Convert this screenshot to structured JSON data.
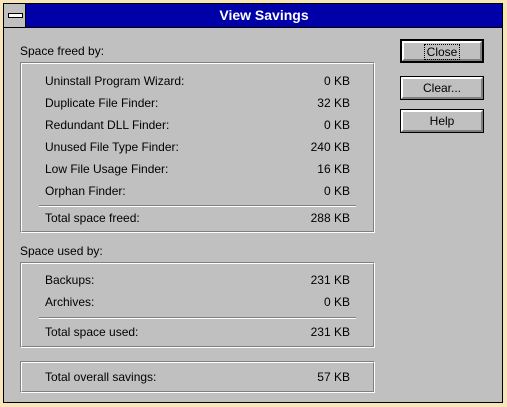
{
  "window": {
    "title": "View Savings"
  },
  "freed": {
    "heading": "Space freed by:",
    "items": [
      {
        "name": "Uninstall Program Wizard:",
        "value": "0 KB"
      },
      {
        "name": "Duplicate File Finder:",
        "value": "32 KB"
      },
      {
        "name": "Redundant DLL Finder:",
        "value": "0 KB"
      },
      {
        "name": "Unused File Type Finder:",
        "value": "240 KB"
      },
      {
        "name": "Low File Usage Finder:",
        "value": "16 KB"
      },
      {
        "name": "Orphan Finder:",
        "value": "0 KB"
      }
    ],
    "total_label": "Total space freed:",
    "total_value": "288 KB"
  },
  "used": {
    "heading": "Space used by:",
    "items": [
      {
        "name": "Backups:",
        "value": "231 KB"
      },
      {
        "name": "Archives:",
        "value": "0 KB"
      }
    ],
    "total_label": "Total space used:",
    "total_value": "231 KB"
  },
  "overall": {
    "label": "Total overall savings:",
    "value": "57 KB"
  },
  "buttons": {
    "close": "Close",
    "clear": "Clear...",
    "help": "Help"
  }
}
